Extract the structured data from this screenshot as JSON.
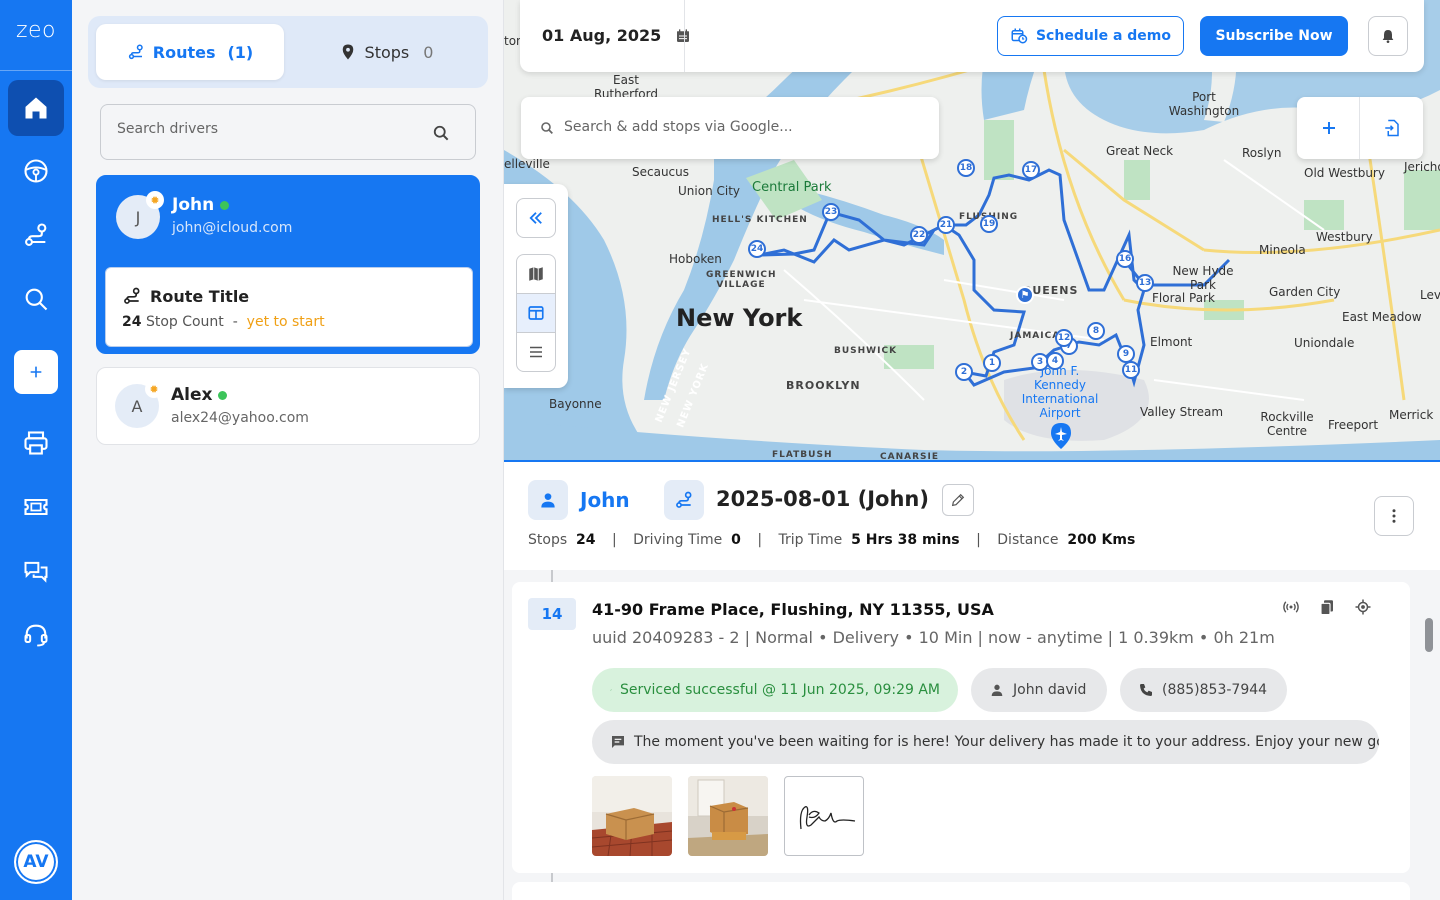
{
  "app": {
    "logo_text": "zeo",
    "user_initials": "AV"
  },
  "rail": {
    "items": [
      {
        "name": "home-icon",
        "active": true
      },
      {
        "name": "steering-wheel-icon"
      },
      {
        "name": "route-icon"
      },
      {
        "name": "search-icon"
      },
      {
        "name": "add-icon"
      },
      {
        "name": "printer-icon"
      },
      {
        "name": "ticket-icon"
      },
      {
        "name": "chat-icon"
      },
      {
        "name": "headset-icon"
      }
    ]
  },
  "panel": {
    "tabs": {
      "routes_label": "Routes",
      "routes_count": "(1)",
      "stops_label": "Stops",
      "stops_count": "0"
    },
    "search_placeholder": "Search drivers",
    "drivers": [
      {
        "initial": "J",
        "name": "John",
        "email": "john@icloud.com",
        "route": {
          "title": "Route Title",
          "stop_count": "24",
          "stop_count_label": "Stop Count",
          "separator": "-",
          "status": "yet to start"
        }
      },
      {
        "initial": "A",
        "name": "Alex",
        "email": "alex24@yahoo.com"
      }
    ]
  },
  "topbar": {
    "date": "01 Aug, 2025",
    "demo_label": "Schedule a demo",
    "subscribe_label": "Subscribe Now"
  },
  "map": {
    "search_placeholder": "Search & add stops via Google...",
    "labels": {
      "city": "New York",
      "park": "Central Park",
      "queens": "QUEENS",
      "brooklyn": "BROOKLYN",
      "bushwick": "BUSHWICK",
      "flatbush": "FLATBUSH",
      "hoboken": "Hoboken",
      "union_city": "Union City",
      "secaucus": "Secaucus",
      "hells_kitchen": "HELL'S KITCHEN",
      "greenwich": "GREENWICH VILLAGE",
      "east_rutherford": "East Rutherford",
      "port_washington": "Port Washington",
      "great_neck": "Great Neck",
      "roslyn": "Roslyn",
      "old_westbury": "Old Westbury",
      "jericho": "Jericho",
      "mineola": "Mineola",
      "westbury": "Westbury",
      "garden_city": "Garden City",
      "new_hyde_park": "New Hyde Park",
      "floral_park": "Floral Park",
      "east_meadow": "East Meadow",
      "elmont": "Elmont",
      "uniondale": "Uniondale",
      "valley_stream": "Valley Stream",
      "rockville_centre": "Rockville Centre",
      "freeport": "Freeport",
      "merrick": "Merrick",
      "airport": "John F. Kennedy International Airport",
      "bayonne": "Bayonne",
      "jamaica": "JAMAICA",
      "flushing": "FLUSHING",
      "new_jersey": "NEW JERSEY",
      "new_york_state": "NEW YORK",
      "canarsie": "CANARSIE",
      "levittown": "Lev",
      "belleville": "elleville",
      "clinton": "ton"
    },
    "stop_markers": [
      "1",
      "2",
      "3",
      "4",
      "7",
      "8",
      "9",
      "11",
      "12",
      "13",
      "16",
      "17",
      "18",
      "19",
      "21",
      "22",
      "23",
      "24"
    ]
  },
  "route_detail": {
    "driver_name": "John",
    "route_title": "2025-08-01 (John)",
    "stats": {
      "stops_label": "Stops",
      "stops_value": "24",
      "driving_label": "Driving Time",
      "driving_value": "0",
      "trip_label": "Trip Time",
      "trip_value": "5 Hrs 38 mins",
      "distance_label": "Distance",
      "distance_value": "200 Kms"
    }
  },
  "stop": {
    "number": "14",
    "address": "41-90 Frame Place, Flushing, NY 11355, USA",
    "meta": "uuid 20409283 - 2 | Normal • Delivery • 10 Min | now - anytime | 1 0.39km • 0h 21m",
    "status_text": "Serviced successful @ 11 Jun 2025, 09:29 AM",
    "contact_name": "John david",
    "contact_phone": "(885)853-7944",
    "note": "The moment you've been waiting for is here! Your delivery has made it to your address. Enjoy your new goods!"
  },
  "colors": {
    "brand": "#1677f2",
    "success": "#2a8f3f",
    "warning": "#f0a015"
  }
}
